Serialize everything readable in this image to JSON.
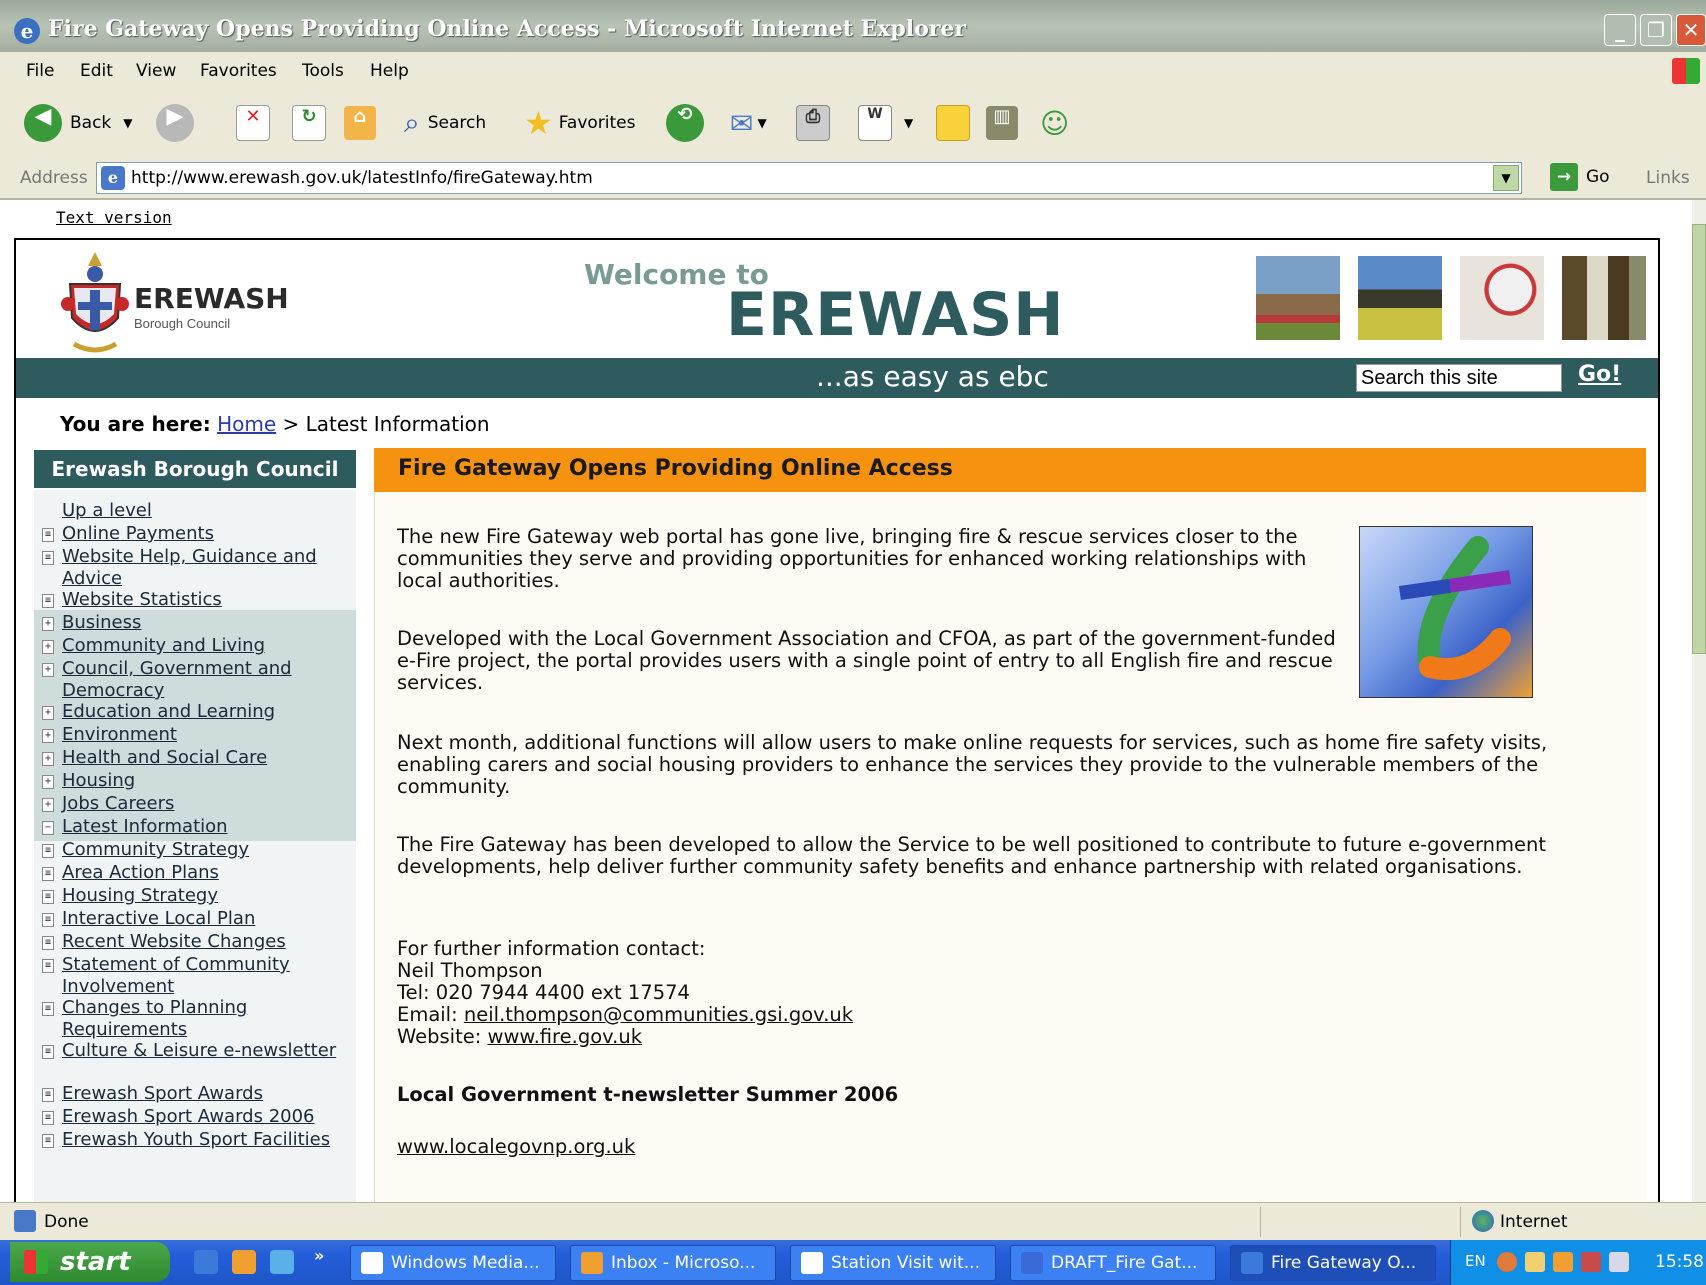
{
  "window": {
    "title": "Fire Gateway Opens Providing Online Access - Microsoft Internet Explorer",
    "controls": [
      "minimize",
      "restore",
      "close"
    ]
  },
  "menu": [
    "File",
    "Edit",
    "View",
    "Favorites",
    "Tools",
    "Help"
  ],
  "toolbar": {
    "back": "Back",
    "search": "Search",
    "favorites": "Favorites"
  },
  "address": {
    "label": "Address",
    "url": "http://www.erewash.gov.uk/latestInfo/fireGateway.htm",
    "go": "Go",
    "links": "Links"
  },
  "page": {
    "text_version": "Text version",
    "logo_name": "EREWASH",
    "logo_sub": "Borough Council",
    "welcome": "Welcome to",
    "big_name": "EREWASH",
    "tagline": "...as easy as ebc",
    "search_value": "Search this site",
    "search_go": "Go!",
    "breadcrumb": {
      "prefix": "You are here:",
      "home": "Home",
      "sep": " > ",
      "current": "Latest Information"
    },
    "nav_heading": "Erewash Borough Council",
    "nav": [
      {
        "label": "Up a level",
        "icon": "none"
      },
      {
        "label": "Online Payments",
        "icon": "page"
      },
      {
        "label": "Website Help, Guidance and Advice",
        "icon": "page"
      },
      {
        "label": "Website Statistics",
        "icon": "page"
      },
      {
        "label": "Business",
        "icon": "plus"
      },
      {
        "label": "Community and Living",
        "icon": "plus"
      },
      {
        "label": "Council, Government and Democracy",
        "icon": "plus"
      },
      {
        "label": "Education and Learning",
        "icon": "plus"
      },
      {
        "label": "Environment",
        "icon": "plus"
      },
      {
        "label": "Health and Social Care",
        "icon": "plus"
      },
      {
        "label": "Housing",
        "icon": "plus"
      },
      {
        "label": "Jobs Careers",
        "icon": "plus"
      },
      {
        "label": "Latest Information",
        "icon": "minus"
      },
      {
        "label": "Community Strategy",
        "icon": "page"
      },
      {
        "label": "Area Action Plans",
        "icon": "page"
      },
      {
        "label": "Housing Strategy",
        "icon": "page"
      },
      {
        "label": "Interactive Local Plan",
        "icon": "page"
      },
      {
        "label": "Recent Website Changes",
        "icon": "page"
      },
      {
        "label": "Statement of Community Involvement",
        "icon": "page"
      },
      {
        "label": "Changes to Planning Requirements",
        "icon": "page"
      },
      {
        "label": "Culture & Leisure e-newsletter",
        "icon": "page"
      },
      {
        "label": "Erewash Sport Awards",
        "icon": "page"
      },
      {
        "label": "Erewash Sport Awards 2006",
        "icon": "page"
      },
      {
        "label": "Erewash Youth Sport Facilities",
        "icon": "page"
      }
    ],
    "article": {
      "heading": "Fire Gateway Opens Providing Online Access",
      "p1": "The new Fire Gateway web portal has gone live, bringing fire & rescue services closer to the communities they serve and providing opportunities for enhanced working relationships with local authorities.",
      "p2": "Developed with the Local Government Association and CFOA, as part of the government-funded e-Fire project, the portal provides users with a single point of entry to all English fire and rescue services.",
      "p3": "Next month, additional functions will allow users to make online requests for services, such as home fire safety visits, enabling carers and social housing providers to enhance the services they provide to the vulnerable members of the community.",
      "p4": "The Fire Gateway has been developed to allow the Service to be well positioned to contribute to future e-government developments, help deliver further community safety benefits and enhance partnership with related organisations.",
      "contact_intro": "For further information contact:",
      "contact_name": "Neil Thompson",
      "contact_tel": "Tel: 020 7944 4400 ext 17574",
      "email_label": "Email: ",
      "email": "neil.thompson@communities.gsi.gov.uk",
      "website_label": "Website: ",
      "website": "www.fire.gov.uk",
      "newsletter": "Local Government t-newsletter Summer 2006",
      "newsletter_link": "www.localegovnp.org.uk"
    }
  },
  "status": {
    "text": "Done",
    "zone": "Internet"
  },
  "taskbar": {
    "start": "start",
    "tasks": [
      "Windows Media...",
      "Inbox - Microso...",
      "Station Visit wit...",
      "DRAFT_Fire Gat...",
      "Fire Gateway O..."
    ],
    "active_index": 4,
    "lang": "EN",
    "clock": "15:58"
  },
  "colors": {
    "brand_teal": "#2e5b5e",
    "accent_orange": "#f5920f"
  }
}
